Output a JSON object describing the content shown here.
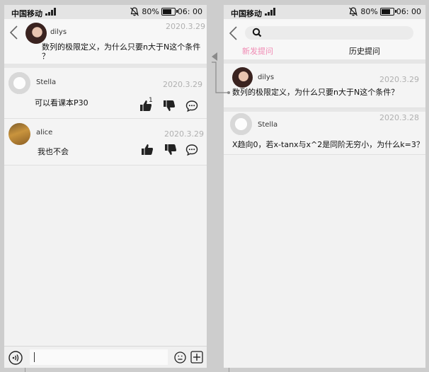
{
  "status_bar": {
    "carrier": "中国移动",
    "battery": "80%",
    "time": "06: 00"
  },
  "detail": {
    "question": {
      "username": "dilys",
      "date": "2020.3.29",
      "text_line1": "数列的极限定义，为什么只要n大于N这个条件",
      "text_line2": "？"
    },
    "replies": [
      {
        "username": "Stella",
        "date": "2020.3.29",
        "text": "可以看课本P30",
        "like_count": "1"
      },
      {
        "username": "alice",
        "date": "2020.3.29",
        "text": "我也不会",
        "like_count": ""
      }
    ],
    "input": {
      "value": "",
      "placeholder": ""
    }
  },
  "list": {
    "search": {
      "value": "",
      "placeholder": ""
    },
    "tabs": [
      {
        "label": "新发提问",
        "active": true
      },
      {
        "label": "历史提问",
        "active": false
      }
    ],
    "questions": [
      {
        "username": "dilys",
        "date": "2020.3.29",
        "text": "数列的极限定义，为什么只要n大于N这个条件？"
      },
      {
        "username": "Stella",
        "date": "2020.3.28",
        "text": "X趋向0，若x-tanx与x^2是同阶无穷小，为什么k=3？"
      }
    ]
  },
  "colors": {
    "accent_tab": "#f08ab3",
    "status_bar": "#e4e4e4",
    "background": "#f2f2f2",
    "canvas": "#cdcdcd",
    "connector": "#8a8a8a"
  },
  "icons": [
    "back-arrow-icon",
    "signal-icon",
    "mute-bell-icon",
    "battery-icon",
    "thumbs-up-icon",
    "thumbs-down-icon",
    "comment-icon",
    "voice-icon",
    "emoji-icon",
    "plus-icon",
    "search-icon"
  ]
}
